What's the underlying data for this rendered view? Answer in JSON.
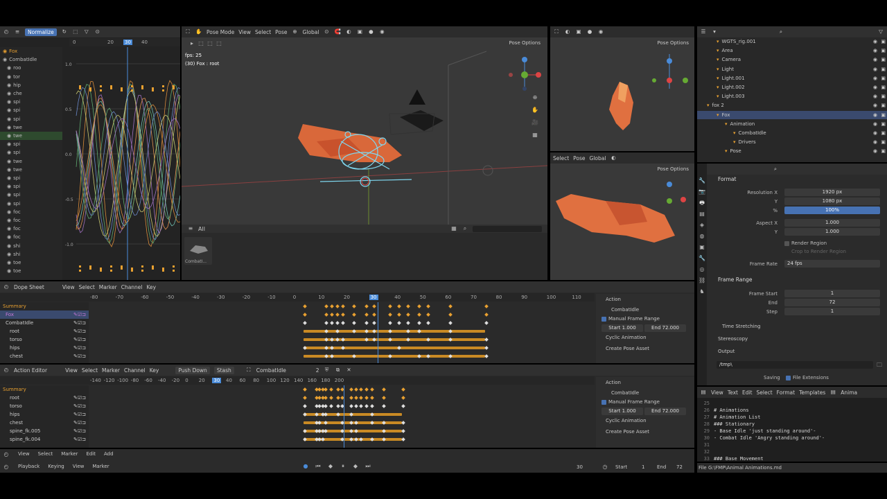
{
  "colors": {
    "accent": "#4772b3",
    "keyframe": "#e8a030",
    "playhead": "#4a8bd8",
    "fox_orange": "#d9683a"
  },
  "graph": {
    "normalize": "Normalize",
    "ticks": [
      "0",
      "20",
      "30",
      "40"
    ],
    "frame_badge": "30",
    "yticks": [
      "1.0",
      "0.5",
      "0.0",
      "-0.5",
      "-1.0"
    ],
    "channels": [
      "Fox",
      "CombatIdle",
      "roo",
      "tor",
      "hip",
      "che",
      "spi",
      "spi",
      "spi",
      "twe",
      "twe",
      "spi",
      "spi",
      "twe",
      "twe",
      "spi",
      "spi",
      "spi",
      "spi",
      "foc",
      "foc",
      "foc",
      "foc",
      "shi",
      "shi",
      "toe",
      "toe"
    ]
  },
  "viewport": {
    "mode": "Pose Mode",
    "menus": [
      "View",
      "Select",
      "Pose"
    ],
    "orientation": "Global",
    "options": "Pose Options",
    "fps": "fps: 25",
    "object": "(30) Fox : root",
    "asset_filter": "All",
    "asset_name": "CombatI..."
  },
  "side_views": {
    "top_options": "Pose Options",
    "mid_menus": [
      "Select",
      "Pose"
    ],
    "orientation": "Global",
    "mid_options": "Pose Options"
  },
  "outliner": {
    "items": [
      {
        "label": "WGTS_rig.001",
        "indent": 0
      },
      {
        "label": "Area",
        "indent": 0
      },
      {
        "label": "Camera",
        "indent": 0
      },
      {
        "label": "Light",
        "indent": 0
      },
      {
        "label": "Light.001",
        "indent": 0
      },
      {
        "label": "Light.002",
        "indent": 0
      },
      {
        "label": "Light.003",
        "indent": 0
      },
      {
        "label": "fox 2",
        "indent": -1
      },
      {
        "label": "Fox",
        "indent": 0,
        "selected": true
      },
      {
        "label": "Animation",
        "indent": 1
      },
      {
        "label": "CombatIdle",
        "indent": 2
      },
      {
        "label": "Drivers",
        "indent": 2
      },
      {
        "label": "Pose",
        "indent": 1
      }
    ]
  },
  "properties": {
    "section": "Format",
    "res_x_label": "Resolution X",
    "res_x": "1920 px",
    "y_label": "Y",
    "res_y": "1080 px",
    "pct_label": "%",
    "pct": "100%",
    "aspect_x_label": "Aspect X",
    "aspect_x": "1.000",
    "aspect_y_label": "Y",
    "aspect_y": "1.000",
    "render_region": "Render Region",
    "crop": "Crop to Render Region",
    "frame_rate_label": "Frame Rate",
    "frame_rate": "24 fps",
    "frame_range": "Frame Range",
    "frame_start_label": "Frame Start",
    "frame_start": "1",
    "end_label": "End",
    "end": "72",
    "step_label": "Step",
    "step": "1",
    "time_stretching": "Time Stretching",
    "stereoscopy": "Stereoscopy",
    "output": "Output",
    "path": "/tmp\\",
    "saving": "Saving",
    "file_ext": "File Extensions"
  },
  "dope": {
    "editor": "Dope Sheet",
    "menus": [
      "View",
      "Select",
      "Marker",
      "Channel",
      "Key"
    ],
    "ticks": [
      "-80",
      "-70",
      "-60",
      "-50",
      "-40",
      "-30",
      "-20",
      "-10",
      "0",
      "10",
      "20",
      "30",
      "40",
      "50",
      "60",
      "70",
      "80",
      "90",
      "100",
      "110"
    ],
    "channels": [
      "Summary",
      "Fox",
      "CombatIdle",
      "root",
      "torso",
      "hips",
      "chest"
    ]
  },
  "action_side": {
    "title": "Action",
    "action_name": "CombatIdle",
    "manual": "Manual Frame Range",
    "start": "Start",
    "start_val": "1.000",
    "end": "End",
    "end_val": "72.000",
    "cyclic": "Cyclic Animation",
    "create": "Create Pose Asset"
  },
  "action": {
    "editor": "Action Editor",
    "menus": [
      "View",
      "Select",
      "Marker",
      "Channel",
      "Key"
    ],
    "push": "Push Down",
    "stash": "Stash",
    "action_name": "CombatIdle",
    "users": "2",
    "ticks": [
      "-140",
      "-120",
      "-100",
      "-80",
      "-60",
      "-40",
      "-20",
      "0",
      "20",
      "30",
      "40",
      "60",
      "80",
      "100",
      "120",
      "140",
      "160",
      "180",
      "200"
    ],
    "channels": [
      "Summary",
      "root",
      "torso",
      "hips",
      "chest",
      "spine_fk.005",
      "spine_fk.004"
    ]
  },
  "text": {
    "menus": [
      "View",
      "Text",
      "Edit",
      "Select",
      "Format",
      "Templates"
    ],
    "tail": "Anima",
    "lines": [
      {
        "n": "25",
        "t": ""
      },
      {
        "n": "26",
        "t": "# Animations"
      },
      {
        "n": "27",
        "t": "# Animation List"
      },
      {
        "n": "28",
        "t": "### Stationary"
      },
      {
        "n": "29",
        "t": "- Base Idle 'just standing around'-"
      },
      {
        "n": "30",
        "t": "- Combat Idle 'Angry standing around'-"
      },
      {
        "n": "31",
        "t": ""
      },
      {
        "n": "32",
        "t": ""
      },
      {
        "n": "33",
        "t": "### Base Movement"
      }
    ]
  },
  "timeline": {
    "menus": [
      "View",
      "Select",
      "Marker",
      "Edit",
      "Add"
    ],
    "playback": "Playback",
    "keying": "Keying",
    "view": "View",
    "marker": "Marker",
    "frame": "30",
    "start_label": "Start",
    "start": "1",
    "end_label": "End",
    "end": "72"
  },
  "status": {
    "file": "File G:\\FMP\\Animal Animations.md"
  }
}
